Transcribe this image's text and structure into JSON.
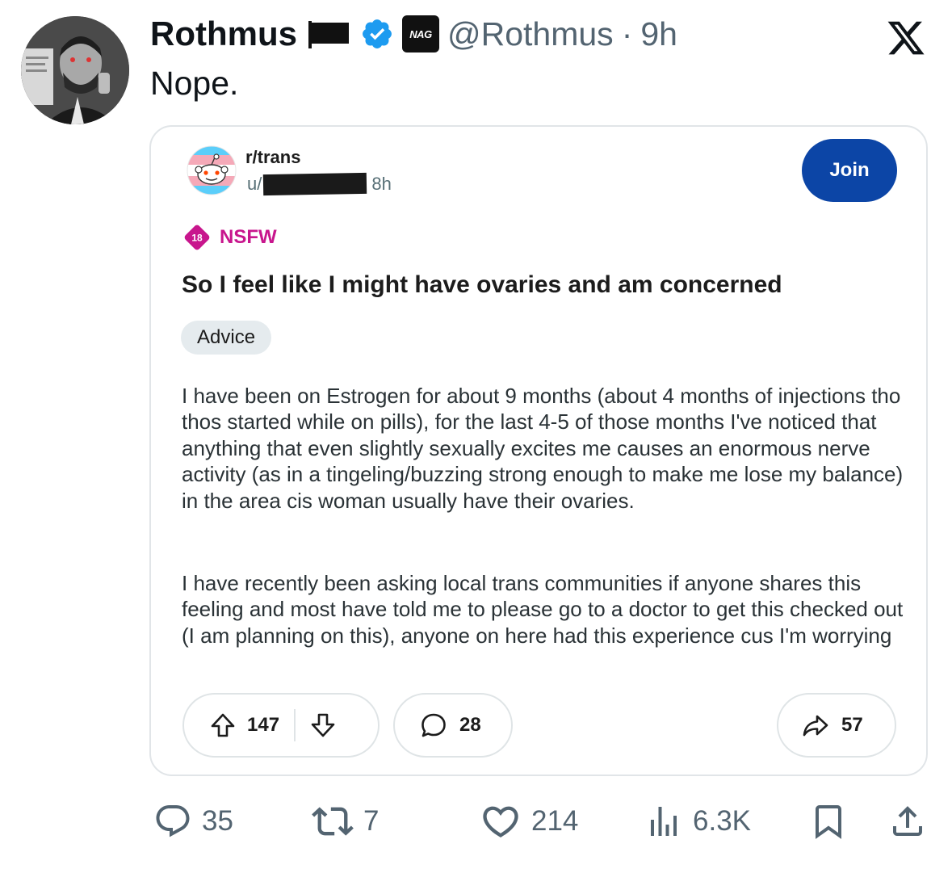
{
  "tweet": {
    "display_name": "Rothmus",
    "flag_emoji": "black-flag",
    "affiliate_badge": "NAG",
    "handle": "@Rothmus",
    "separator": "·",
    "time": "9h",
    "text": "Nope.",
    "platform_icon": "x-logo",
    "colors": {
      "verified": "#1d9bf0",
      "secondary_text": "#536471"
    }
  },
  "reddit_post": {
    "subreddit": "r/trans",
    "username_prefix": "u/",
    "time": "8h",
    "join_label": "Join",
    "nsfw_age": "18",
    "nsfw_label": "NSFW",
    "title": "So I feel like I might have ovaries and am concerned",
    "flair": "Advice",
    "body_paragraphs": [
      "I have been on Estrogen for about 9 months (about 4 months of injections tho thos started while on pills), for the last 4-5 of those months I've noticed that anything that even slightly sexually excites me causes an enormous nerve activity (as in a tingeling/buzzing strong enough to make me lose my balance) in the area cis woman usually have their ovaries.",
      "I have recently been asking local trans communities if anyone shares this feeling and most have told me to please go to a doctor to get this checked out (I am planning on this), anyone on here had this experience cus I'm worrying"
    ],
    "upvotes": "147",
    "comments": "28",
    "shares": "57",
    "colors": {
      "join_button": "#0c45a6",
      "nsfw": "#c8168d"
    }
  },
  "tweet_actions": {
    "replies": "35",
    "reposts": "7",
    "likes": "214",
    "views": "6.3K"
  }
}
